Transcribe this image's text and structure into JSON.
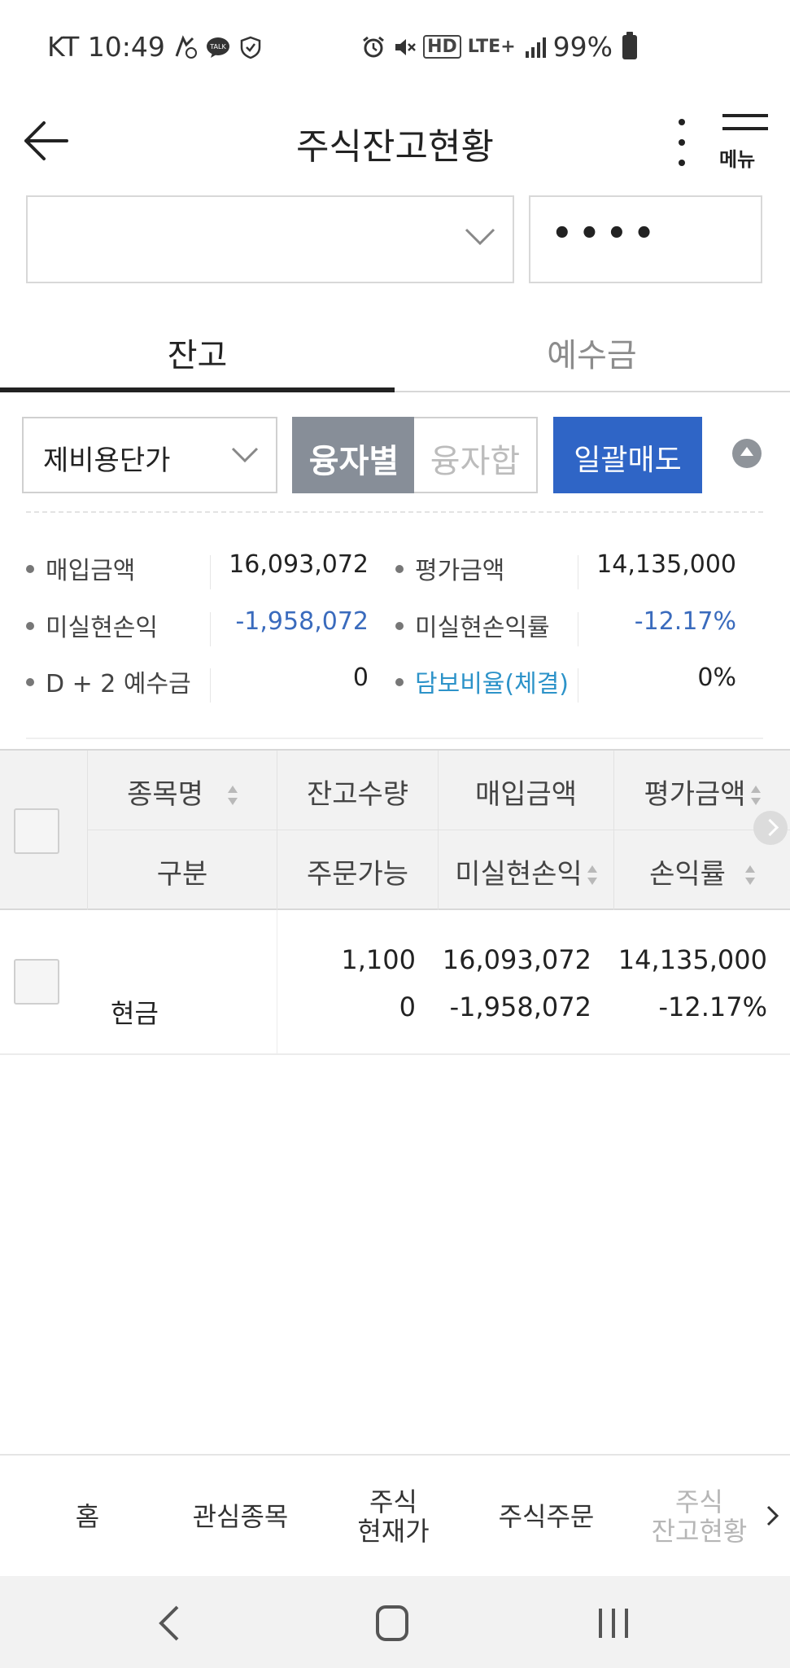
{
  "status_bar": {
    "carrier_time": "KT 10:49",
    "talk_badge": "TALK",
    "hd_label": "HD",
    "lte_label": "LTE+",
    "battery": "99%"
  },
  "header": {
    "title": "주식잔고현황",
    "menu_label": "메뉴"
  },
  "account": {
    "selected": "",
    "password_mask": "••••"
  },
  "tabs": [
    {
      "label": "잔고",
      "active": true
    },
    {
      "label": "예수금",
      "active": false
    }
  ],
  "controls": {
    "price_type": "제비용단가",
    "segment_on": "융자별",
    "segment_off": "융자합",
    "bulk_sell": "일괄매도"
  },
  "summary": {
    "rows": [
      {
        "l1": "매입금액",
        "v1": "16,093,072",
        "l2": "평가금액",
        "v2": "14,135,000"
      },
      {
        "l1": "미실현손익",
        "v1": "-1,958,072",
        "l2": "미실현손익률",
        "v2": "-12.17%"
      },
      {
        "l1": "D + 2 예수금",
        "v1": "0",
        "l2": "담보비율(체결)",
        "v2": "0%"
      }
    ]
  },
  "table": {
    "headers_top": [
      "종목명",
      "잔고수량",
      "매입금액",
      "평가금액"
    ],
    "headers_bottom": [
      "구분",
      "주문가능",
      "미실현손익",
      "손익률"
    ],
    "rows": [
      {
        "name": "",
        "type": "현금",
        "balance_qty": "1,100",
        "orderable_qty": "0",
        "purchase_amount": "16,093,072",
        "unrealized_pl": "-1,958,072",
        "eval_amount": "14,135,000",
        "pl_rate": "-12.17%"
      }
    ]
  },
  "bottom_nav": [
    {
      "label": "홈"
    },
    {
      "label": "관심종목"
    },
    {
      "label": "주식\n현재가"
    },
    {
      "label": "주식주문"
    },
    {
      "label": "주식\n잔고현황"
    }
  ],
  "colors": {
    "accent_blue": "#2f65c6",
    "negative_blue": "#3a6bbd",
    "segment_gray": "#878e98"
  }
}
